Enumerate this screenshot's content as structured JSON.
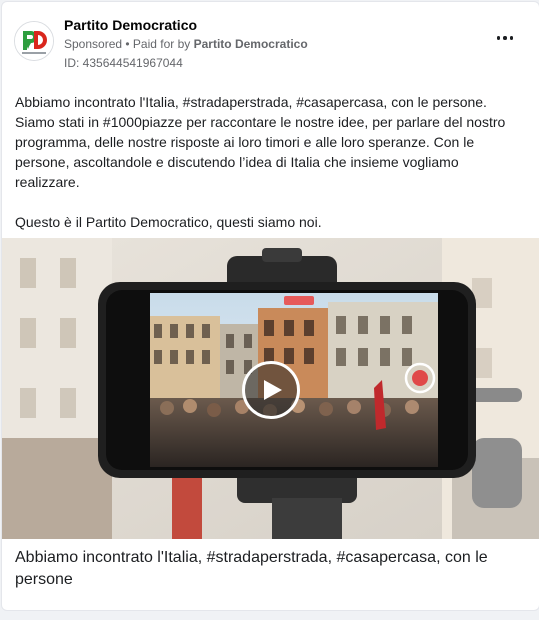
{
  "post": {
    "page_name": "Partito Democratico",
    "sponsored_label": "Sponsored",
    "separator": " • ",
    "paid_for_prefix": "Paid for by ",
    "paid_for_by": "Partito Democratico",
    "ad_id": "ID: 435644541967044",
    "avatar_logo_text": "PD",
    "avatar_caption": "Partito Democratico",
    "body": [
      "Abbiamo incontrato l'Italia, #stradaperstrada, #casapercasa, con le persone.",
      "Siamo stati in #1000piazze per raccontare le nostre idee, per parlare del nostro programma, delle nostre risposte ai loro timori e alle loro speranze. Con le persone, ascoltandole e discutendo l’idea di Italia che insieme vogliamo realizzare.",
      "Questo è il Partito Democratico, questi siamo noi.",
      "..."
    ],
    "media_caption": "Abbiamo incontrato l'Italia, #stradaperstrada, #casapercasa, con le persone"
  },
  "icons": {
    "more": "more-horizontal-icon",
    "play": "play-icon"
  },
  "colors": {
    "pd_green": "#2e9e3f",
    "pd_red": "#d9261c",
    "muted_text": "#65676b",
    "card_bg": "#ffffff",
    "page_bg": "#f0f2f5"
  }
}
